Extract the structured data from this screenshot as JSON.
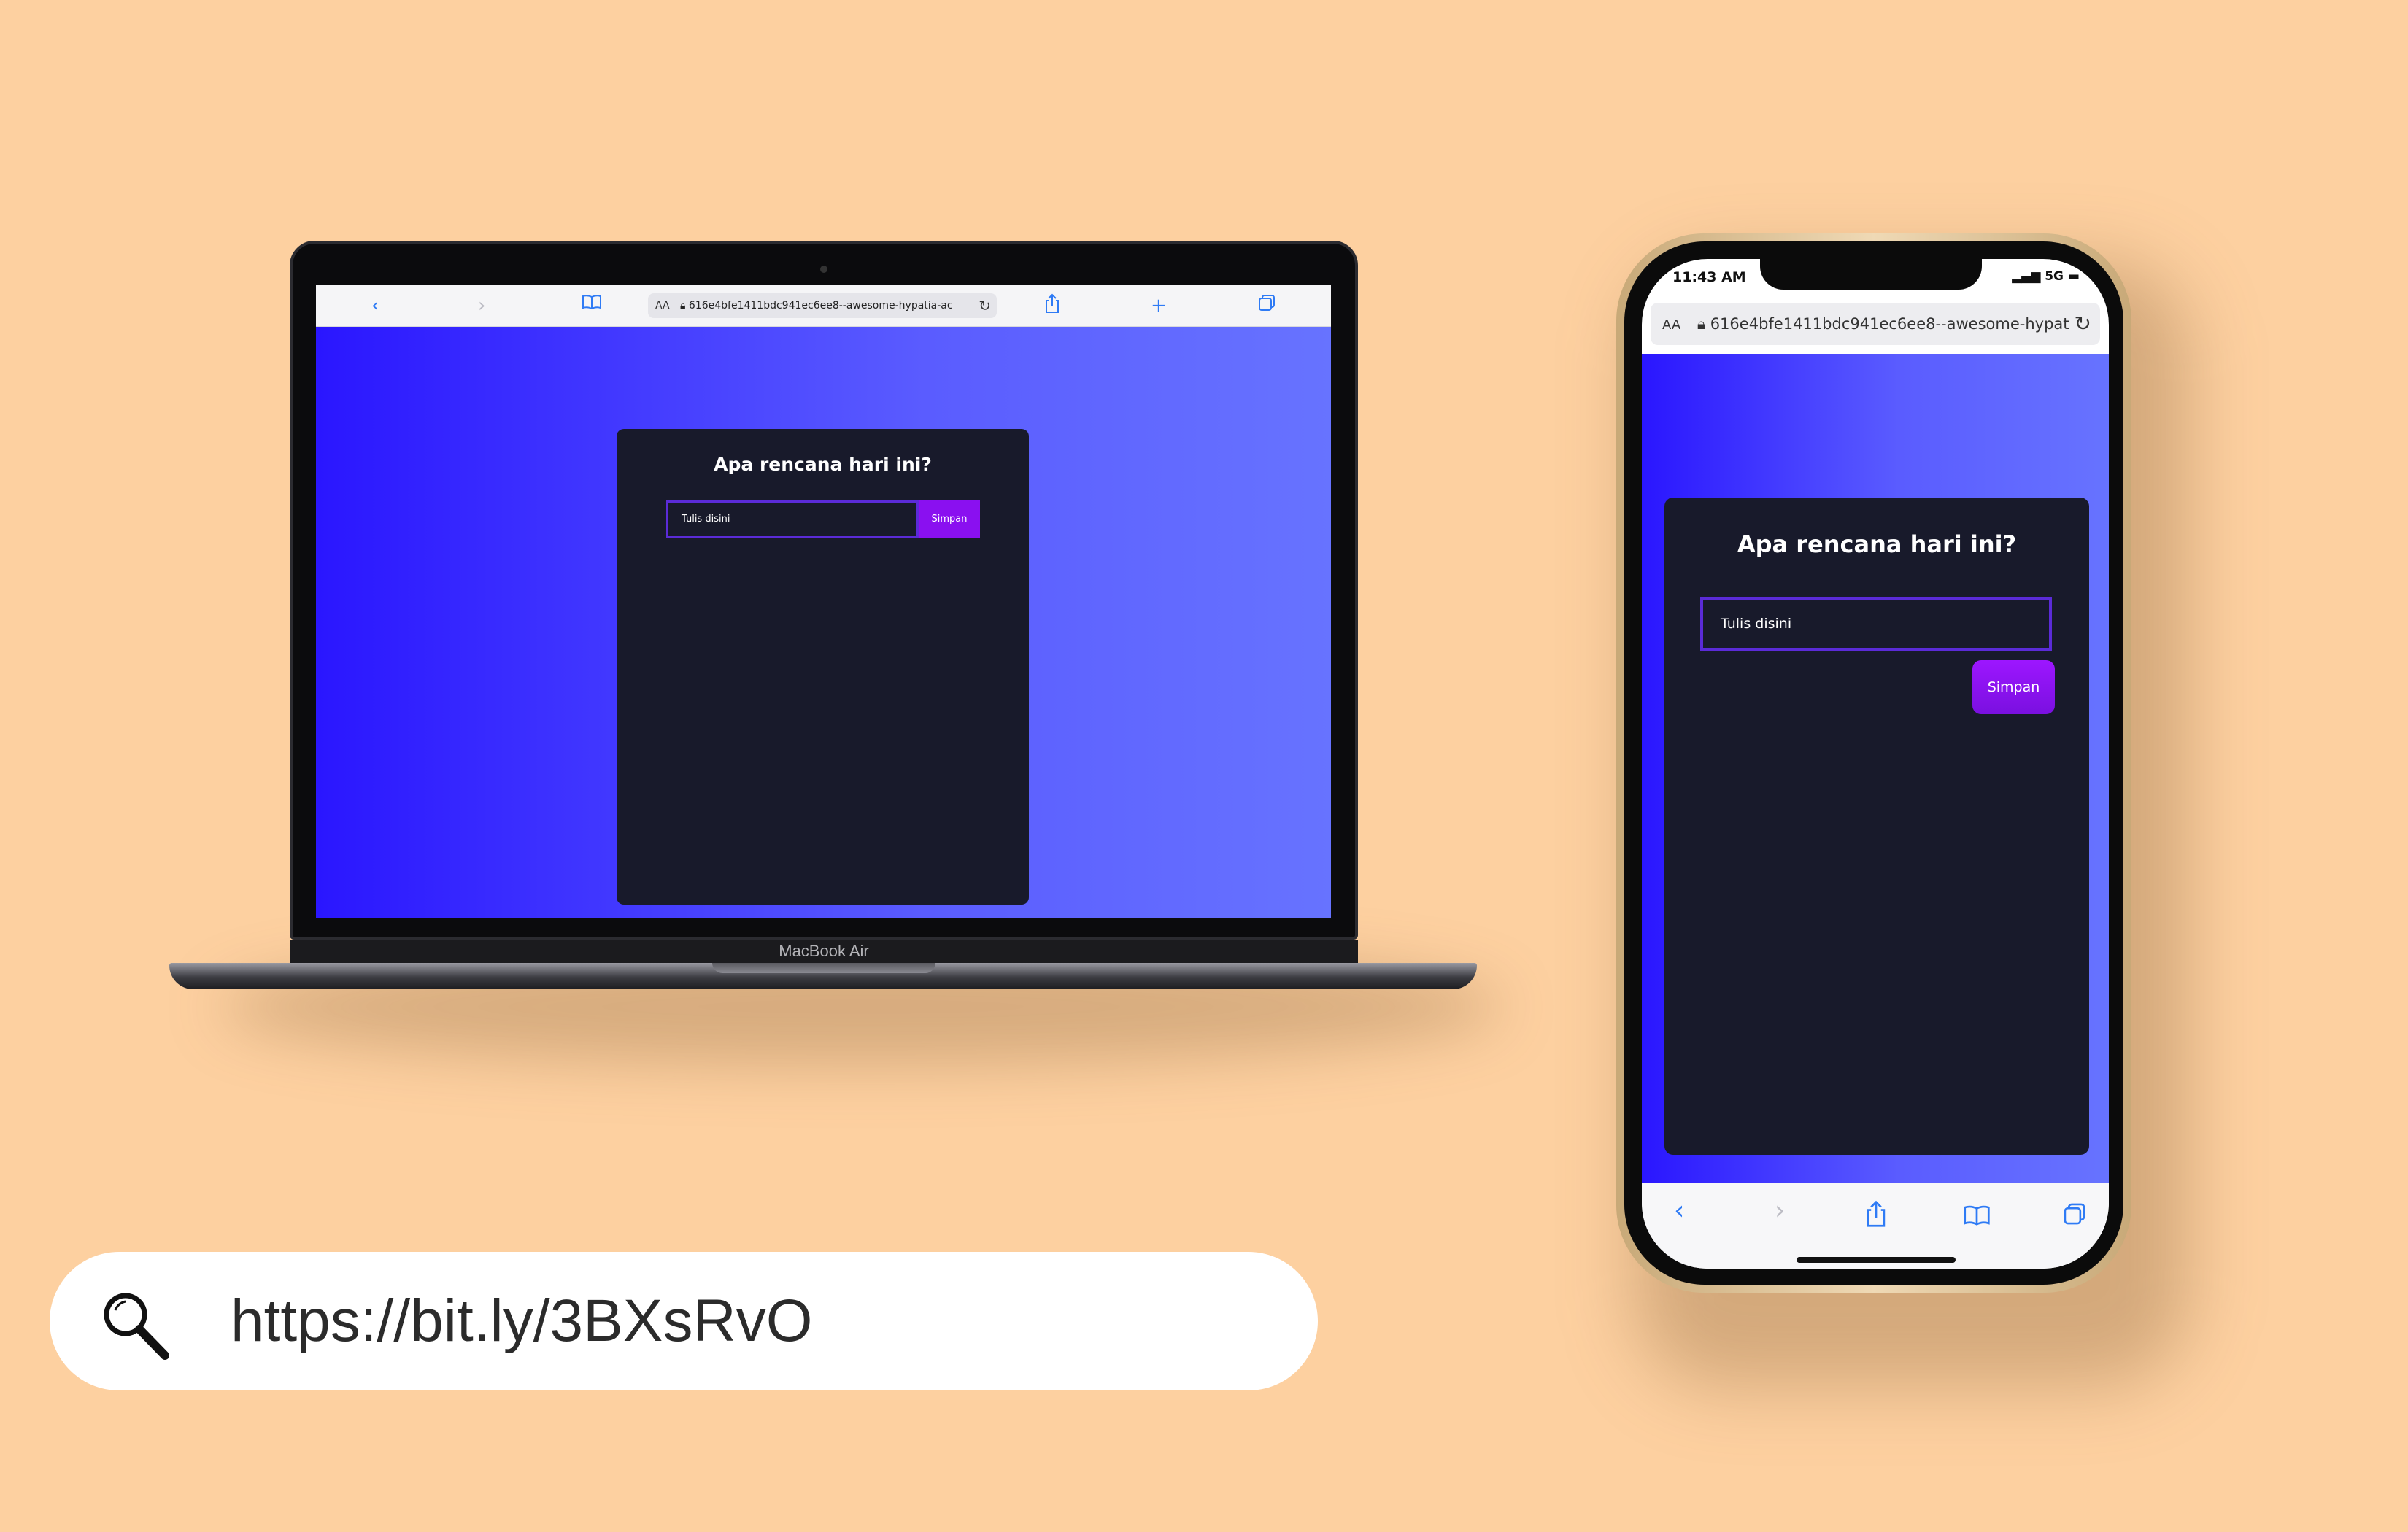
{
  "laptop": {
    "brand_label": "MacBook Air",
    "browser": {
      "url": "616e4bfe1411bdc941ec6ee8--awesome-hypatia-ac",
      "aa_label": "AA"
    },
    "app": {
      "title": "Apa rencana hari ini?",
      "input_placeholder": "Tulis disini",
      "button_label": "Simpan"
    }
  },
  "phone": {
    "status_time": "11:43 AM",
    "status_network": "5G",
    "browser": {
      "url": "616e4bfe1411bdc941ec6ee8--awesome-hypat",
      "aa_label": "AA"
    },
    "app": {
      "title": "Apa rencana hari ini?",
      "input_placeholder": "Tulis disini",
      "button_label": "Simpan"
    }
  },
  "link": {
    "url": "https://bit.ly/3BXsRvO"
  },
  "colors": {
    "background": "#fdd0a0",
    "gradient_start": "#2a16ff",
    "gradient_end": "#6773ff",
    "card": "#181a2b",
    "button": "#8a10f0",
    "input_border": "#5b2bd8",
    "safari_blue": "#2f7bf5"
  },
  "icons": [
    "back-icon",
    "forward-icon",
    "bookmarks-icon",
    "lock-icon",
    "reload-icon",
    "share-icon",
    "plus-icon",
    "tabs-icon",
    "search-icon"
  ]
}
